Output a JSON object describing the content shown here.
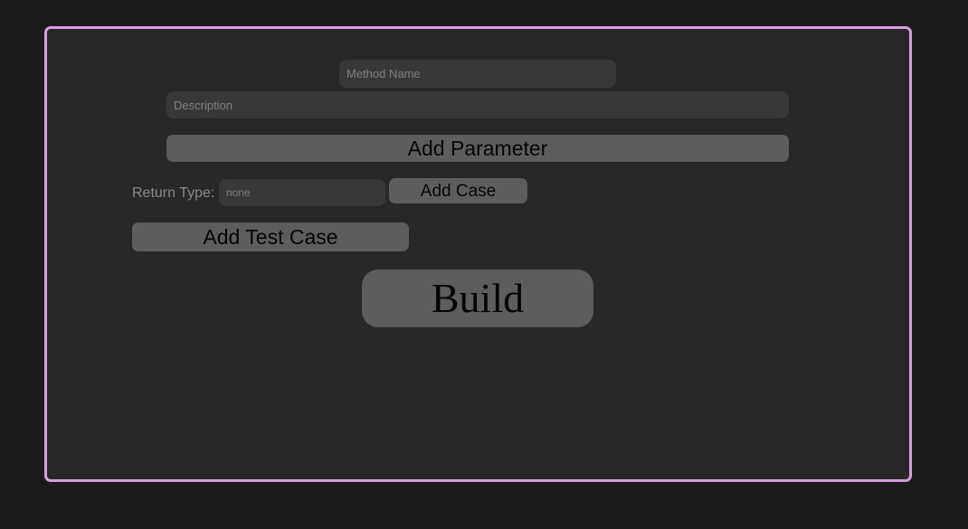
{
  "form": {
    "method_name_placeholder": "Method Name",
    "description_placeholder": "Description",
    "add_parameter_label": "Add Parameter",
    "return_type_label": "Return Type:",
    "return_type_placeholder": "none",
    "add_case_label": "Add Case",
    "add_test_case_label": "Add Test Case",
    "build_label": "Build"
  },
  "colors": {
    "page_background": "#1b1b1b",
    "panel_background": "#282828",
    "panel_border": "#d99ee0",
    "input_background": "#383838",
    "button_background": "#5d5d5d",
    "button_text": "#050505",
    "label_text": "#8a8a8a"
  }
}
